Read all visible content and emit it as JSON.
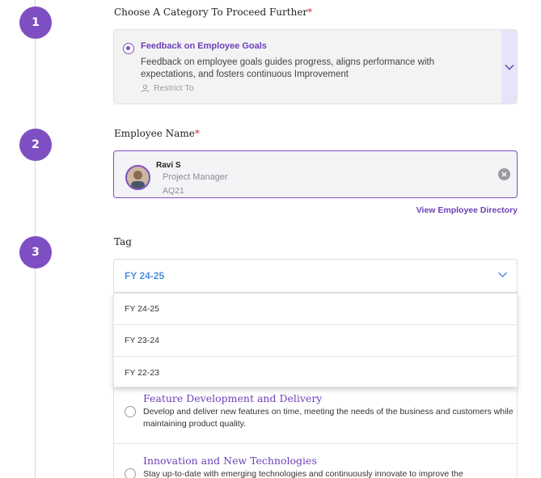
{
  "steps": [
    "1",
    "2",
    "3"
  ],
  "category": {
    "label": "Choose A Category To Proceed Further",
    "required_mark": "*",
    "selected_title": "Feedback on Employee Goals",
    "selected_desc": "Feedback on employee goals guides progress, aligns performance with expectations, and fosters continuous Improvement",
    "restrict_label": "Restrict To"
  },
  "employee": {
    "label": "Employee Name",
    "required_mark": "*",
    "name": "Ravi S",
    "role": "Project Manager",
    "code": "AQ21",
    "view_directory": "View Employee Directory"
  },
  "tag": {
    "label": "Tag",
    "selected": "FY 24-25",
    "options": [
      "FY 24-25",
      "FY 23-24",
      "FY 22-23"
    ]
  },
  "goals": [
    {
      "title": "Feature Development and Delivery",
      "desc": "Develop and deliver new features on time, meeting the needs of the business and customers while maintaining product quality."
    },
    {
      "title": "Innovation and New Technologies",
      "desc": "Stay up-to-date with emerging technologies and continuously innovate to improve the"
    }
  ],
  "colors": {
    "accent": "#7e4fc2",
    "link": "#6c3fb8",
    "tag_value": "#4f8fdf",
    "required": "#d0303b"
  },
  "icons": {
    "cat_radio": "radio-selected-icon",
    "restrict": "user-icon",
    "chevron": "chevron-down-icon",
    "clear": "close-circle-icon"
  }
}
